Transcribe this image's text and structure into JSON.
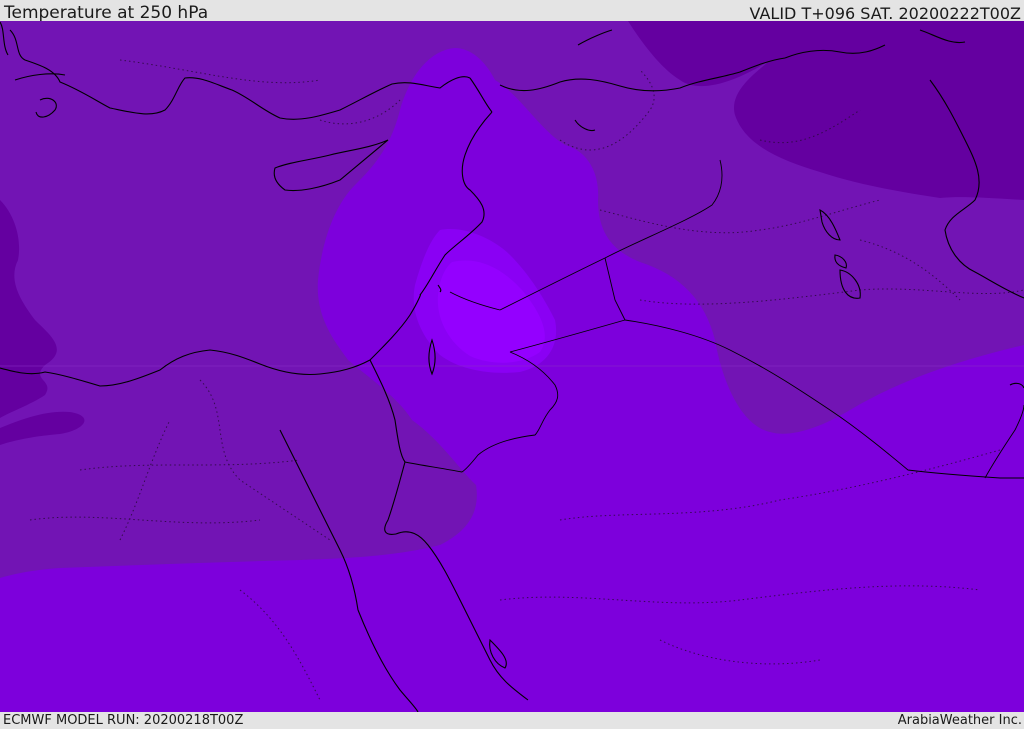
{
  "header": {
    "title": "Temperature at 250 hPa",
    "valid_time": "VALID T+096 SAT. 20200222T00Z"
  },
  "footer": {
    "model_run": "ECMWF MODEL RUN: 20200218T00Z",
    "credit": "ArabiaWeather Inc."
  },
  "colors": {
    "band_darkest": "#6400a0",
    "band_dark": "#7214b4",
    "band_mid": "#7d00dc",
    "band_light": "#8a00f4",
    "band_lightest": "#9400ff",
    "coastline": "#000000",
    "admin_border": "#2a0a3c"
  }
}
